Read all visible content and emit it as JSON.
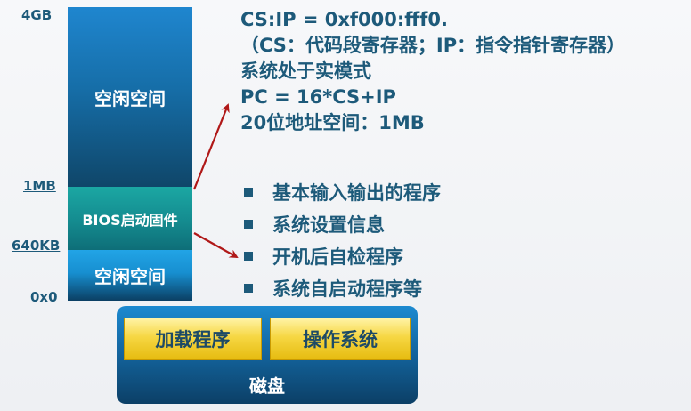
{
  "memory_map": {
    "addresses": {
      "top": "4GB",
      "bios_start": "1MB",
      "low_end": "640KB",
      "zero": "0x0"
    },
    "blocks": {
      "free_top": "空闲空间",
      "bios": "BIOS启动固件",
      "free_bottom": "空闲空间"
    }
  },
  "info": {
    "line1": "CS:IP = 0xf000:fff0.",
    "line2": "（CS：代码段寄存器；IP：指令指针寄存器）",
    "line3": "系统处于实模式",
    "line4": "PC = 16*CS+IP",
    "line5": "20位地址空间：1MB"
  },
  "bullets": [
    "基本输入输出的程序",
    "系统设置信息",
    "开机后自检程序",
    "系统自启动程序等"
  ],
  "disk": {
    "loader": "加载程序",
    "os": "操作系统",
    "label": "磁盘"
  },
  "colors": {
    "text": "#1d5a7a",
    "arrow": "#b01818",
    "disk_box": "#f6d743"
  }
}
